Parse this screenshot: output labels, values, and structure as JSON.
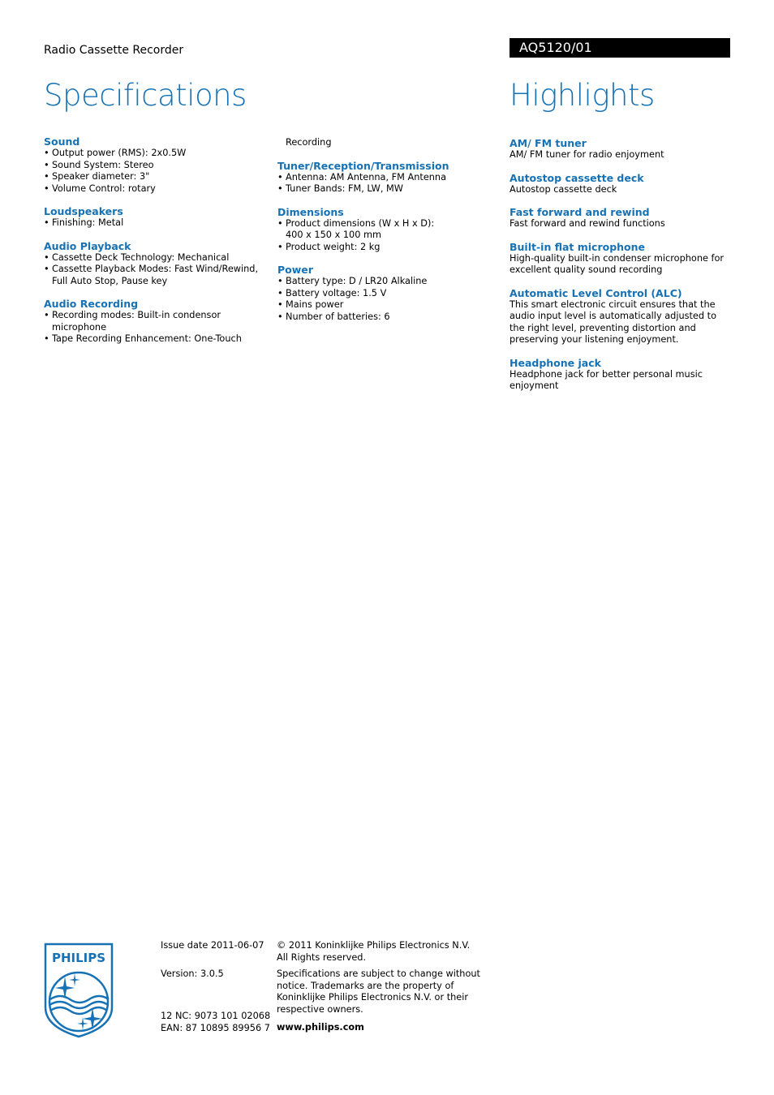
{
  "header": {
    "doc_type": "Radio Cassette Recorder",
    "model": "AQ5120/01",
    "spec_title": "Specifications",
    "highlights_title": "Highlights"
  },
  "colors": {
    "accent": "#1672b4",
    "model_bar": "#000000"
  },
  "specs": {
    "sound": {
      "title": "Sound",
      "items": [
        "Output power (RMS): 2x0.5W",
        "Sound System: Stereo",
        "Speaker diameter: 3\"",
        "Volume Control: rotary"
      ]
    },
    "loudspeakers": {
      "title": "Loudspeakers",
      "items": [
        "Finishing: Metal"
      ]
    },
    "audio_playback": {
      "title": "Audio Playback",
      "items": [
        "Cassette Deck Technology: Mechanical",
        "Cassette Playback Modes: Fast Wind/Rewind, Full Auto Stop, Pause key"
      ]
    },
    "audio_recording": {
      "title": "Audio Recording",
      "items": [
        "Recording modes: Built-in condensor microphone",
        "Tape Recording Enhancement: One-Touch"
      ],
      "continuation": "Recording"
    },
    "tuner": {
      "title": "Tuner/Reception/Transmission",
      "items": [
        "Antenna: AM Antenna, FM Antenna",
        "Tuner Bands: FM, LW, MW"
      ]
    },
    "dimensions": {
      "title": "Dimensions",
      "items": [
        "Product dimensions (W x H x D): 400 x 150 x 100 mm",
        "Product weight: 2 kg"
      ]
    },
    "power": {
      "title": "Power",
      "items": [
        "Battery type: D / LR20 Alkaline",
        "Battery voltage: 1.5 V",
        "Mains power",
        "Number of batteries: 6"
      ]
    }
  },
  "highlights": [
    {
      "title": "AM/ FM tuner",
      "text": "AM/ FM tuner for radio enjoyment"
    },
    {
      "title": "Autostop cassette deck",
      "text": "Autostop cassette deck"
    },
    {
      "title": "Fast forward and rewind",
      "text": "Fast forward and rewind functions"
    },
    {
      "title": "Built-in flat microphone",
      "text": "High-quality built-in condenser microphone for excellent quality sound recording"
    },
    {
      "title": "Automatic Level Control (ALC)",
      "text": "This smart electronic circuit ensures that the audio input level is automatically adjusted to the right level, preventing distortion and preserving your listening enjoyment."
    },
    {
      "title": "Headphone jack",
      "text": "Headphone jack for better personal music enjoyment"
    }
  ],
  "footer": {
    "logo_text": "PHILIPS",
    "issue_date": "Issue date 2011-06-07",
    "version": "Version: 3.0.5",
    "nc": "12 NC: 9073 101 02068",
    "ean": "EAN: 87 10895 89956 7",
    "copyright": "© 2011 Koninklijke Philips Electronics N.V.",
    "rights": "All Rights reserved.",
    "disclaimer": "Specifications are subject to change without notice. Trademarks are the property of Koninklijke Philips Electronics N.V. or their respective owners.",
    "website": "www.philips.com"
  }
}
